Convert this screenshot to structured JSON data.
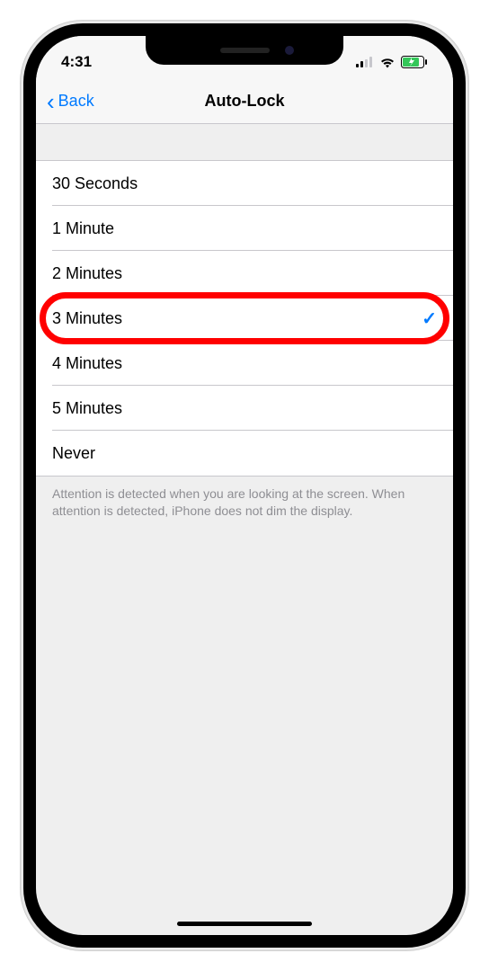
{
  "status": {
    "time": "4:31"
  },
  "nav": {
    "back_label": "Back",
    "title": "Auto-Lock"
  },
  "options": [
    {
      "label": "30 Seconds",
      "selected": false,
      "highlighted": false
    },
    {
      "label": "1 Minute",
      "selected": false,
      "highlighted": false
    },
    {
      "label": "2 Minutes",
      "selected": false,
      "highlighted": false
    },
    {
      "label": "3 Minutes",
      "selected": true,
      "highlighted": true
    },
    {
      "label": "4 Minutes",
      "selected": false,
      "highlighted": false
    },
    {
      "label": "5 Minutes",
      "selected": false,
      "highlighted": false
    },
    {
      "label": "Never",
      "selected": false,
      "highlighted": false
    }
  ],
  "footer": "Attention is detected when you are looking at the screen. When attention is detected, iPhone does not dim the display."
}
